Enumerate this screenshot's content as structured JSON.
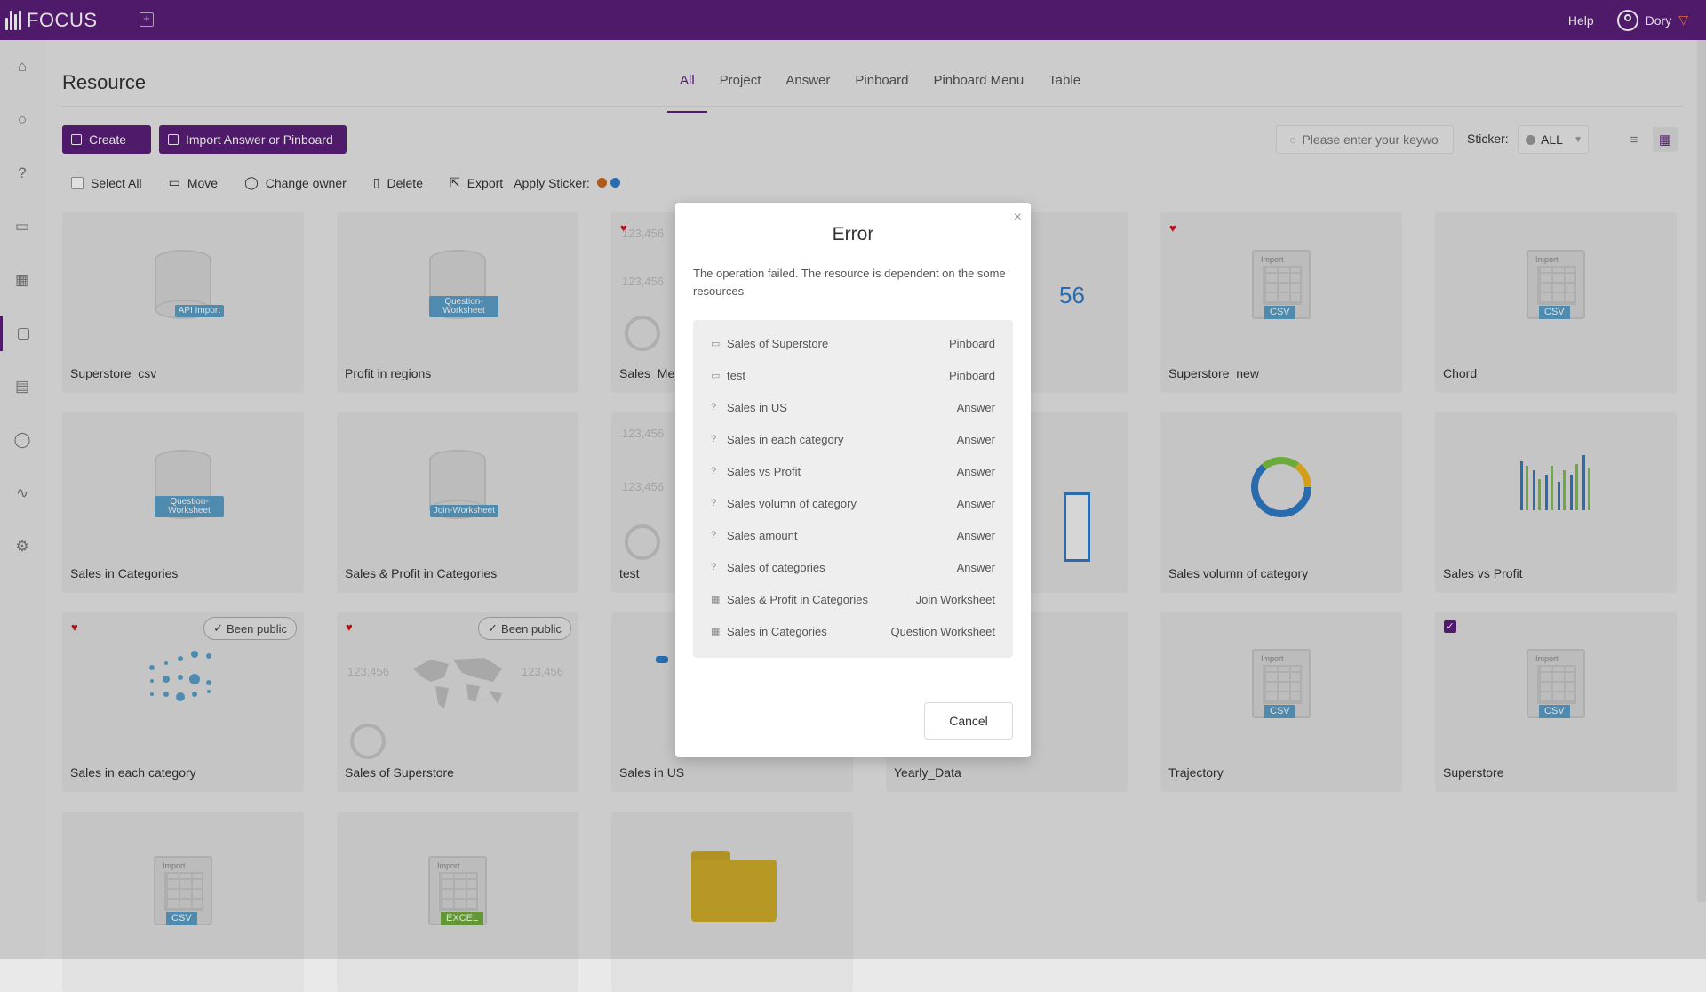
{
  "app": {
    "name": "FOCUS",
    "help": "Help",
    "user": "Dory"
  },
  "page": {
    "title": "Resource"
  },
  "tabs": [
    "All",
    "Project",
    "Answer",
    "Pinboard",
    "Pinboard Menu",
    "Table"
  ],
  "actions": {
    "create": "Create",
    "import": "Import Answer or Pinboard"
  },
  "search": {
    "placeholder": "Please enter your keywo"
  },
  "sticker": {
    "label": "Sticker:",
    "value": "ALL"
  },
  "toolbar": {
    "select_all": "Select All",
    "move": "Move",
    "change_owner": "Change owner",
    "delete": "Delete",
    "export": "Export",
    "apply_sticker": "Apply Sticker:"
  },
  "sticker_colors": [
    "#c8651b",
    "#2f7ac4"
  ],
  "cards": [
    {
      "name": "Superstore_csv",
      "thumb": "database",
      "tag": "API Import"
    },
    {
      "name": "Profit in regions",
      "thumb": "database",
      "tag": "Question-Worksheet"
    },
    {
      "name": "Sales_Men",
      "thumb": "map"
    },
    {
      "name": "",
      "thumb": "number"
    },
    {
      "name": "Superstore_new",
      "thumb": "sheet",
      "tag": "CSV"
    },
    {
      "name": "Chord",
      "thumb": "sheet",
      "tag": "CSV"
    },
    {
      "name": "Sales in Categories",
      "thumb": "database",
      "tag": "Question-Worksheet"
    },
    {
      "name": "Sales & Profit in Categories",
      "thumb": "database",
      "tag": "Join-Worksheet"
    },
    {
      "name": "test",
      "thumb": "map"
    },
    {
      "name": "",
      "thumb": "table"
    },
    {
      "name": "Sales volumn of category",
      "thumb": "donut"
    },
    {
      "name": "Sales vs Profit",
      "thumb": "bars"
    },
    {
      "name": "Sales in each category",
      "thumb": "dots",
      "public": "Been public"
    },
    {
      "name": "Sales of Superstore",
      "thumb": "world",
      "public": "Been public"
    },
    {
      "name": "Sales in US",
      "thumb": "map"
    },
    {
      "name": "Yearly_Data",
      "thumb": "sheet"
    },
    {
      "name": "Trajectory",
      "thumb": "sheet",
      "tag": "CSV"
    },
    {
      "name": "Superstore",
      "thumb": "sheet",
      "tag": "CSV"
    },
    {
      "name": "",
      "thumb": "sheet",
      "tag": "CSV"
    },
    {
      "name": "",
      "thumb": "sheet",
      "tag": "EXCEL"
    },
    {
      "name": "",
      "thumb": "folder"
    }
  ],
  "thumb_numbers": {
    "small": "123,456",
    "big": "56"
  },
  "modal": {
    "title": "Error",
    "message": "The operation failed. The resource is dependent on the some resources",
    "dependencies": [
      {
        "name": "Sales of Superstore",
        "type": "Pinboard",
        "icon": "pinboard-icon"
      },
      {
        "name": "test",
        "type": "Pinboard",
        "icon": "pinboard-icon"
      },
      {
        "name": "Sales in US",
        "type": "Answer",
        "icon": "question-icon"
      },
      {
        "name": "Sales in each category",
        "type": "Answer",
        "icon": "question-icon"
      },
      {
        "name": "Sales vs Profit",
        "type": "Answer",
        "icon": "question-icon"
      },
      {
        "name": "Sales volumn of category",
        "type": "Answer",
        "icon": "question-icon"
      },
      {
        "name": "Sales amount",
        "type": "Answer",
        "icon": "question-icon"
      },
      {
        "name": "Sales of categories",
        "type": "Answer",
        "icon": "question-icon"
      },
      {
        "name": "Sales & Profit in Categories",
        "type": "Join Worksheet",
        "icon": "table-icon"
      },
      {
        "name": "Sales in Categories",
        "type": "Question Worksheet",
        "icon": "table-icon"
      }
    ],
    "cancel": "Cancel"
  },
  "colors": {
    "brand": "#5b1e78",
    "heart": "#d0121b",
    "tag": "#5a9fc8"
  }
}
